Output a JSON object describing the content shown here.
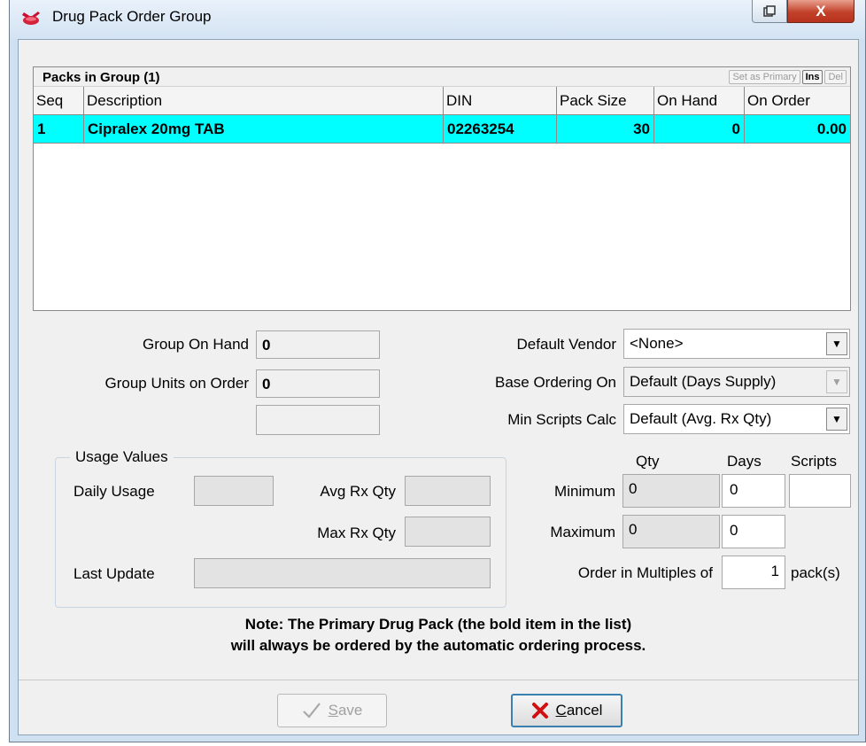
{
  "window": {
    "title": "Drug Pack Order Group",
    "close_label": "X"
  },
  "packs": {
    "title": "Packs in Group (1)",
    "buttons": [
      "Set as Primary",
      "Ins",
      "Del"
    ],
    "columns": [
      "Seq",
      "Description",
      "DIN",
      "Pack Size",
      "On Hand",
      "On Order"
    ],
    "rows": [
      {
        "seq": "1",
        "description": "Cipralex 20mg TAB",
        "din": "02263254",
        "pack_size": "30",
        "on_hand": "0",
        "on_order": "0.00"
      }
    ],
    "selected_row_color": "#00ffff"
  },
  "group": {
    "on_hand_label": "Group On Hand",
    "on_hand_value": "0",
    "units_on_order_label": "Group Units on Order",
    "units_on_order_value": "0",
    "extra_value": ""
  },
  "vendor": {
    "default_vendor_label": "Default Vendor",
    "default_vendor_value": "<None>",
    "base_ordering_label": "Base Ordering On",
    "base_ordering_value": "Default (Days Supply)",
    "min_scripts_label": "Min Scripts Calc",
    "min_scripts_value": "Default (Avg. Rx Qty)"
  },
  "usage": {
    "legend": "Usage Values",
    "daily_usage_label": "Daily Usage",
    "daily_usage_value": "",
    "avg_rx_label": "Avg Rx Qty",
    "avg_rx_value": "",
    "max_rx_label": "Max Rx Qty",
    "max_rx_value": "",
    "last_update_label": "Last Update",
    "last_update_value": ""
  },
  "limits": {
    "qty_header": "Qty",
    "days_header": "Days",
    "scripts_header": "Scripts",
    "minimum_label": "Minimum",
    "minimum_qty": "0",
    "minimum_days": "0",
    "minimum_scripts": "",
    "maximum_label": "Maximum",
    "maximum_qty": "0",
    "maximum_days": "0",
    "multiples_label": "Order in Multiples of",
    "multiples_value": "1",
    "multiples_unit": "pack(s)"
  },
  "note": {
    "line1": "Note: The Primary Drug Pack (the bold item in the list)",
    "line2": "will always be ordered by the automatic ordering process."
  },
  "buttons": {
    "save_rest": "ave",
    "save_hotkey": "S",
    "cancel_hotkey": "C",
    "cancel_rest": "ancel"
  },
  "icons": [
    "pill-app-icon",
    "restore-icon",
    "close-icon",
    "dropdown-arrow-icon",
    "checkmark-icon",
    "red-x-icon"
  ]
}
